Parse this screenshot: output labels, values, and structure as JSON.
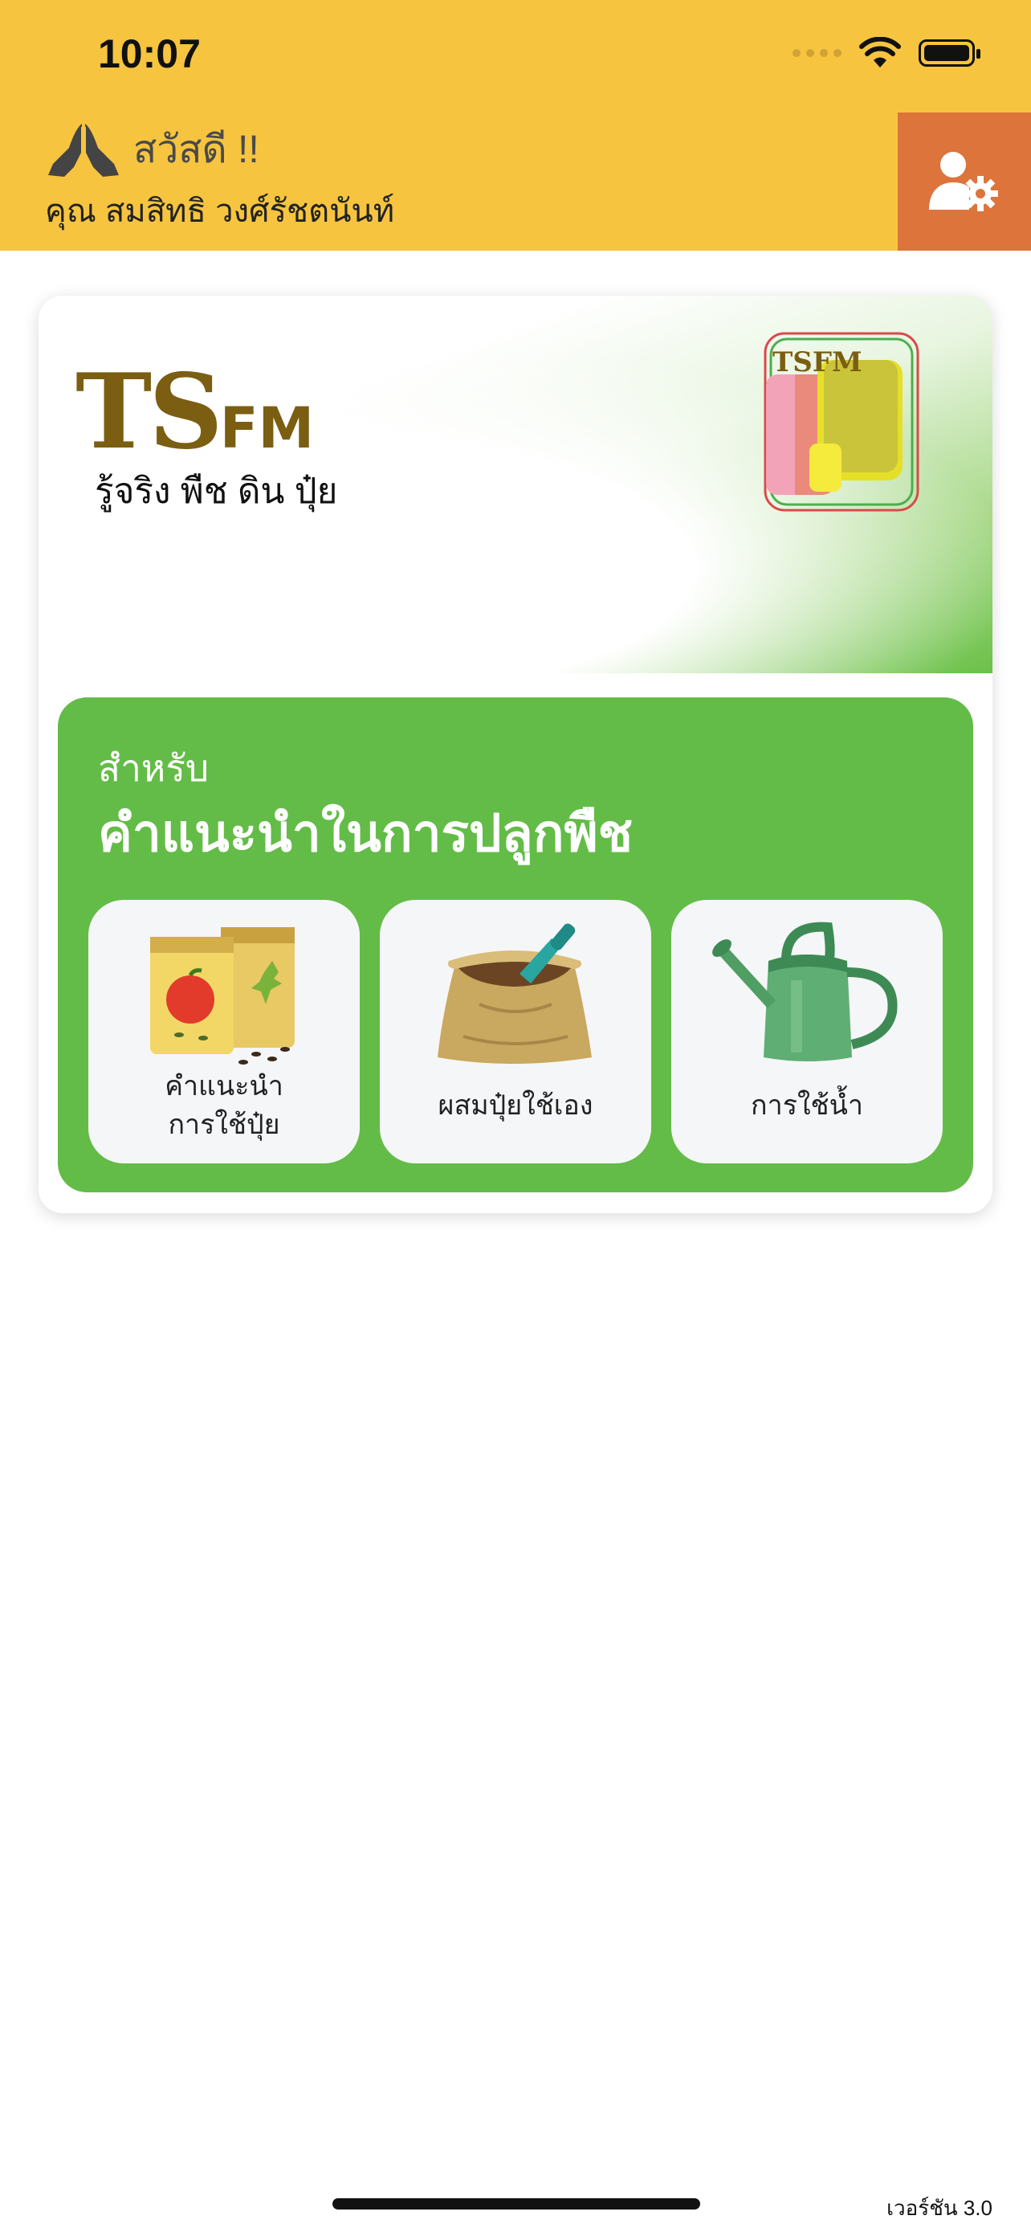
{
  "status_bar": {
    "time": "10:07"
  },
  "header": {
    "greeting": "สวัสดี !!",
    "user_name": "คุณ สมสิทธิ วงศ์รัชตนันท์",
    "icons": {
      "greeting": "praying-hands-icon",
      "profile": "user-settings-icon"
    }
  },
  "card": {
    "brand_main": "TS",
    "brand_suffix": "FM",
    "tagline": "รู้จริง พืช ดิน ปุ๋ย",
    "logo_text": "TSFM",
    "panel": {
      "subtitle": "สำหรับ",
      "title": "คำแนะนำในการปลูกพืช",
      "tiles": [
        {
          "label_line1": "คำแนะนำ",
          "label_line2": "การใช้ปุ๋ย",
          "icon": "seed-packets-icon"
        },
        {
          "label": "ผสมปุ๋ยใช้เอง",
          "icon": "fertilizer-sack-icon"
        },
        {
          "label": "การใช้น้ำ",
          "icon": "watering-can-icon"
        }
      ]
    }
  },
  "footer": {
    "version": "เวอร์ชัน 3.0"
  },
  "colors": {
    "header_bg": "#F6C43F",
    "profile_bg": "#DC743C",
    "panel_green": "#63BC47",
    "brand": "#7B5E12"
  }
}
